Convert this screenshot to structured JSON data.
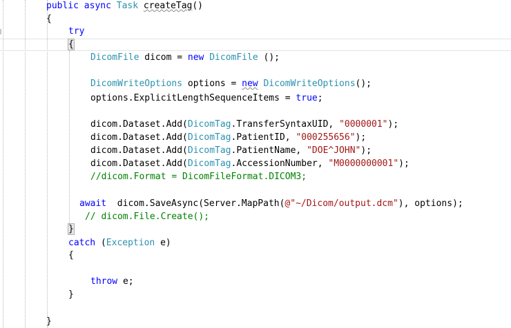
{
  "code_lines": {
    "l01": {
      "kw1": "public",
      "kw2": "async",
      "type": "Task",
      "name": "createTag",
      "rest": "()"
    },
    "l02": "{",
    "l03": "try",
    "l04": "{",
    "l05": {
      "type1": "DicomFile",
      "mid1": " dicom = ",
      "kw": "new",
      "sp": " ",
      "type2": "DicomFile",
      "end": " ();"
    },
    "l06": {
      "type1": "DicomWriteOptions",
      "mid1": " options = ",
      "kw": "new",
      "sp": " ",
      "type2": "DicomWriteOptions",
      "end": "();"
    },
    "l07": {
      "text": "options.ExplicitLengthSequenceItems = ",
      "kw": "true",
      "end": ";"
    },
    "l08": {
      "pre": "dicom.Dataset.Add(",
      "type": "DicomTag",
      "mid": ".TransferSyntaxUID, ",
      "str": "\"0000001\"",
      "end": ");"
    },
    "l09": {
      "pre": "dicom.Dataset.Add(",
      "type": "DicomTag",
      "mid": ".PatientID, ",
      "str": "\"000255656\"",
      "end": ");"
    },
    "l10": {
      "pre": "dicom.Dataset.Add(",
      "type": "DicomTag",
      "mid": ".PatientName, ",
      "str": "\"DOE^JOHN\"",
      "end": ");"
    },
    "l11": {
      "pre": "dicom.Dataset.Add(",
      "type": "DicomTag",
      "mid": ".AccessionNumber, ",
      "str": "\"M0000000001\"",
      "end": ");"
    },
    "l12": "//dicom.Format = DicomFileFormat.DICOM3;",
    "l13": {
      "kw": "await",
      "pre": "  dicom.SaveAsync(Server.MapPath(",
      "str": "@\"~/Dicom/output.dcm\"",
      "end": "), options);"
    },
    "l14": "// dicom.File.Create();",
    "l15": "}",
    "l16": {
      "kw": "catch",
      "mid": " (",
      "type": "Exception",
      "end": " e)"
    },
    "l17": "{",
    "l18": {
      "kw": "throw",
      "end": " e;"
    },
    "l19": "}",
    "l20": "}"
  },
  "colors": {
    "keyword": "#0000ff",
    "type": "#2b91af",
    "string": "#a31515",
    "comment": "#008000",
    "text": "#000000"
  }
}
